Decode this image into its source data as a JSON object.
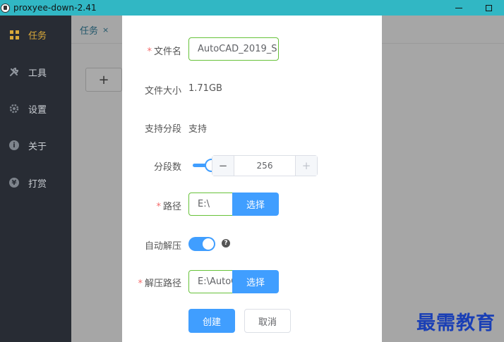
{
  "window": {
    "title": "proxyee-down-2.41",
    "minimize_icon": "minimize-icon",
    "maximize_icon": "maximize-icon"
  },
  "sidebar": {
    "items": [
      {
        "label": "任务",
        "icon": "grid-icon",
        "active": true
      },
      {
        "label": "工具",
        "icon": "wrench-icon"
      },
      {
        "label": "设置",
        "icon": "gear-icon"
      },
      {
        "label": "关于",
        "icon": "info-icon"
      },
      {
        "label": "打赏",
        "icon": "yen-icon"
      }
    ],
    "active_color": "#d9a93a"
  },
  "main": {
    "tab_label": "任务",
    "tab_close": "×",
    "add_label": "+"
  },
  "dialog": {
    "filename": {
      "label": "文件名",
      "value": "AutoCAD_2019_S"
    },
    "filesize": {
      "label": "文件大小",
      "value": "1.71GB"
    },
    "segment_support": {
      "label": "支持分段",
      "value": "支持"
    },
    "segments": {
      "label": "分段数",
      "value": "256",
      "minus": "−",
      "plus": "+",
      "slider_fraction": 0.5
    },
    "path": {
      "label": "路径",
      "value": "E:\\",
      "button": "选择"
    },
    "auto_unzip": {
      "label": "自动解压",
      "enabled": true,
      "help": "?"
    },
    "unzip_path": {
      "label": "解压路径",
      "value": "E:\\AutoC",
      "button": "选择"
    },
    "required_mark": "*",
    "submit": "创建",
    "cancel": "取消"
  },
  "watermark": "最需教育",
  "colors": {
    "titlebar": "#31b7c4",
    "primary": "#409eff",
    "required": "#f56c6c",
    "success_border": "#67c23a"
  }
}
